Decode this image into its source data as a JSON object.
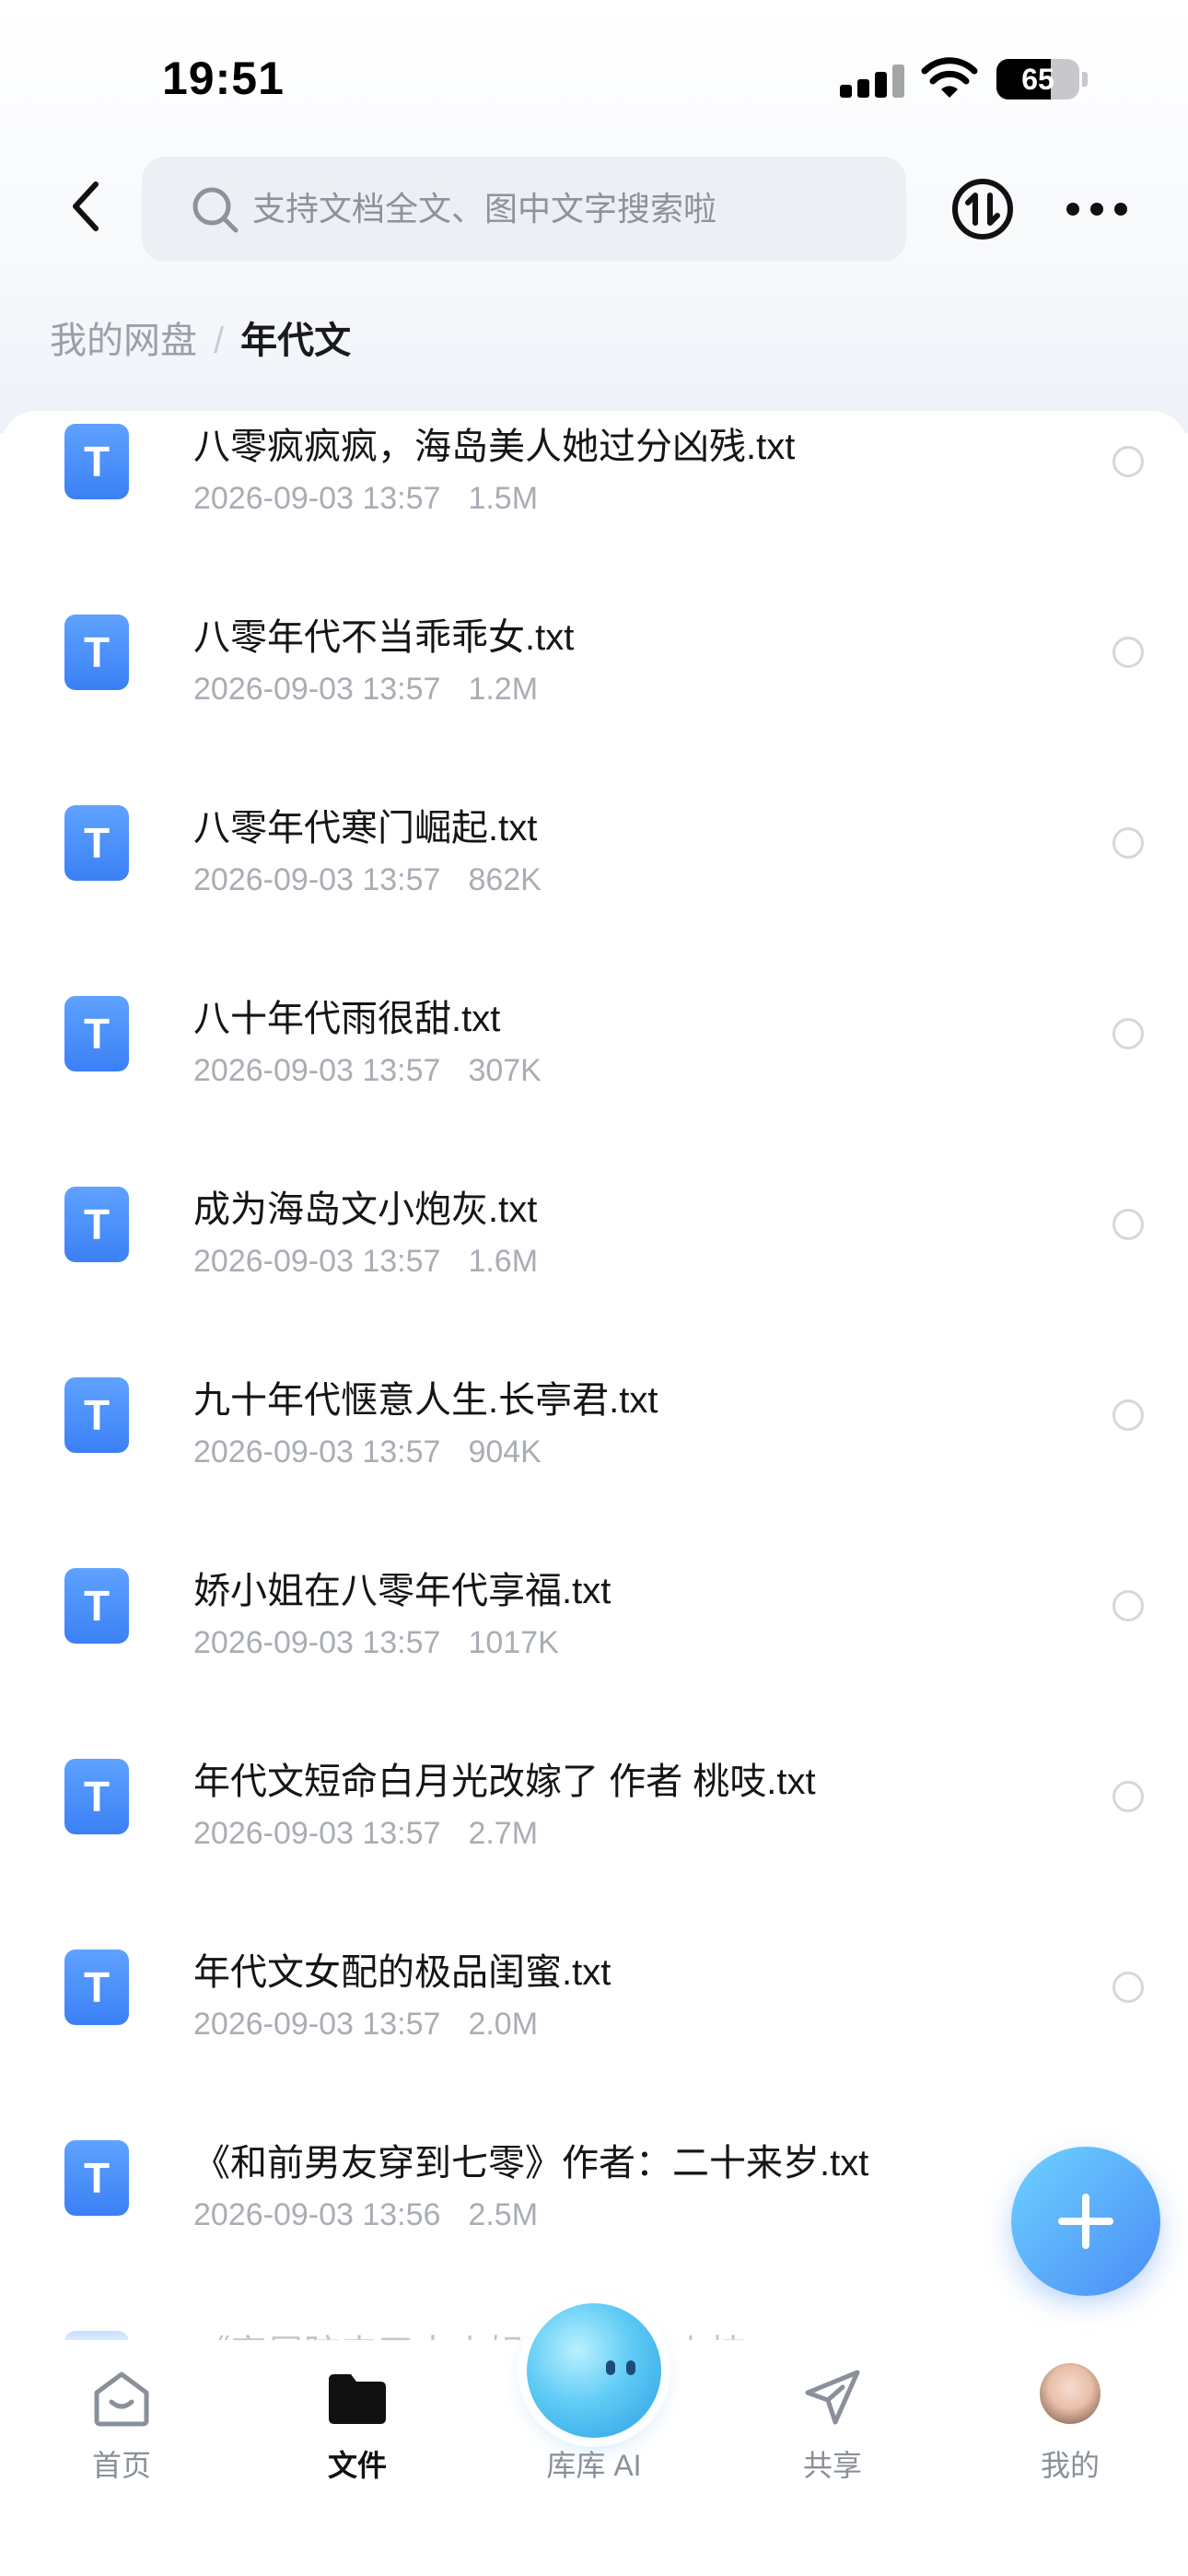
{
  "status_bar": {
    "time": "19:51",
    "battery_pct": "65",
    "battery_level": 0.65
  },
  "header": {
    "search_placeholder": "支持文档全文、图中文字搜索啦"
  },
  "breadcrumb": {
    "root": "我的网盘",
    "separator": "/",
    "current": "年代文"
  },
  "file_icon_letter": "T",
  "files": [
    {
      "name": "八零疯疯疯，海岛美人她过分凶残.txt",
      "date": "2026-09-03 13:57",
      "size": "1.5M"
    },
    {
      "name": "八零年代不当乖乖女.txt",
      "date": "2026-09-03 13:57",
      "size": "1.2M"
    },
    {
      "name": "八零年代寒门崛起.txt",
      "date": "2026-09-03 13:57",
      "size": "862K"
    },
    {
      "name": "八十年代雨很甜.txt",
      "date": "2026-09-03 13:57",
      "size": "307K"
    },
    {
      "name": "成为海岛文小炮灰.txt",
      "date": "2026-09-03 13:57",
      "size": "1.6M"
    },
    {
      "name": "九十年代惬意人生.长亭君.txt",
      "date": "2026-09-03 13:57",
      "size": "904K"
    },
    {
      "name": "娇小姐在八零年代享福.txt",
      "date": "2026-09-03 13:57",
      "size": "1017K"
    },
    {
      "name": "年代文短命白月光改嫁了 作者 桃吱.txt",
      "date": "2026-09-03 13:57",
      "size": "2.7M"
    },
    {
      "name": "年代文女配的极品闺蜜.txt",
      "date": "2026-09-03 13:57",
      "size": "2.0M"
    },
    {
      "name": "《和前男友穿到七零》作者：二十来岁.txt",
      "date": "2026-09-03 13:56",
      "size": "2.5M"
    },
    {
      "name": "《家属院来了大小姐》作者：山楂",
      "date": "",
      "size": ""
    }
  ],
  "tabs": {
    "home": "首页",
    "files": "文件",
    "ai": "库库 AI",
    "share": "共享",
    "mine": "我的"
  },
  "colors": {
    "accent": "#3b80f5",
    "fab": "#5aa8fa",
    "muted_text": "#a9adb4"
  }
}
